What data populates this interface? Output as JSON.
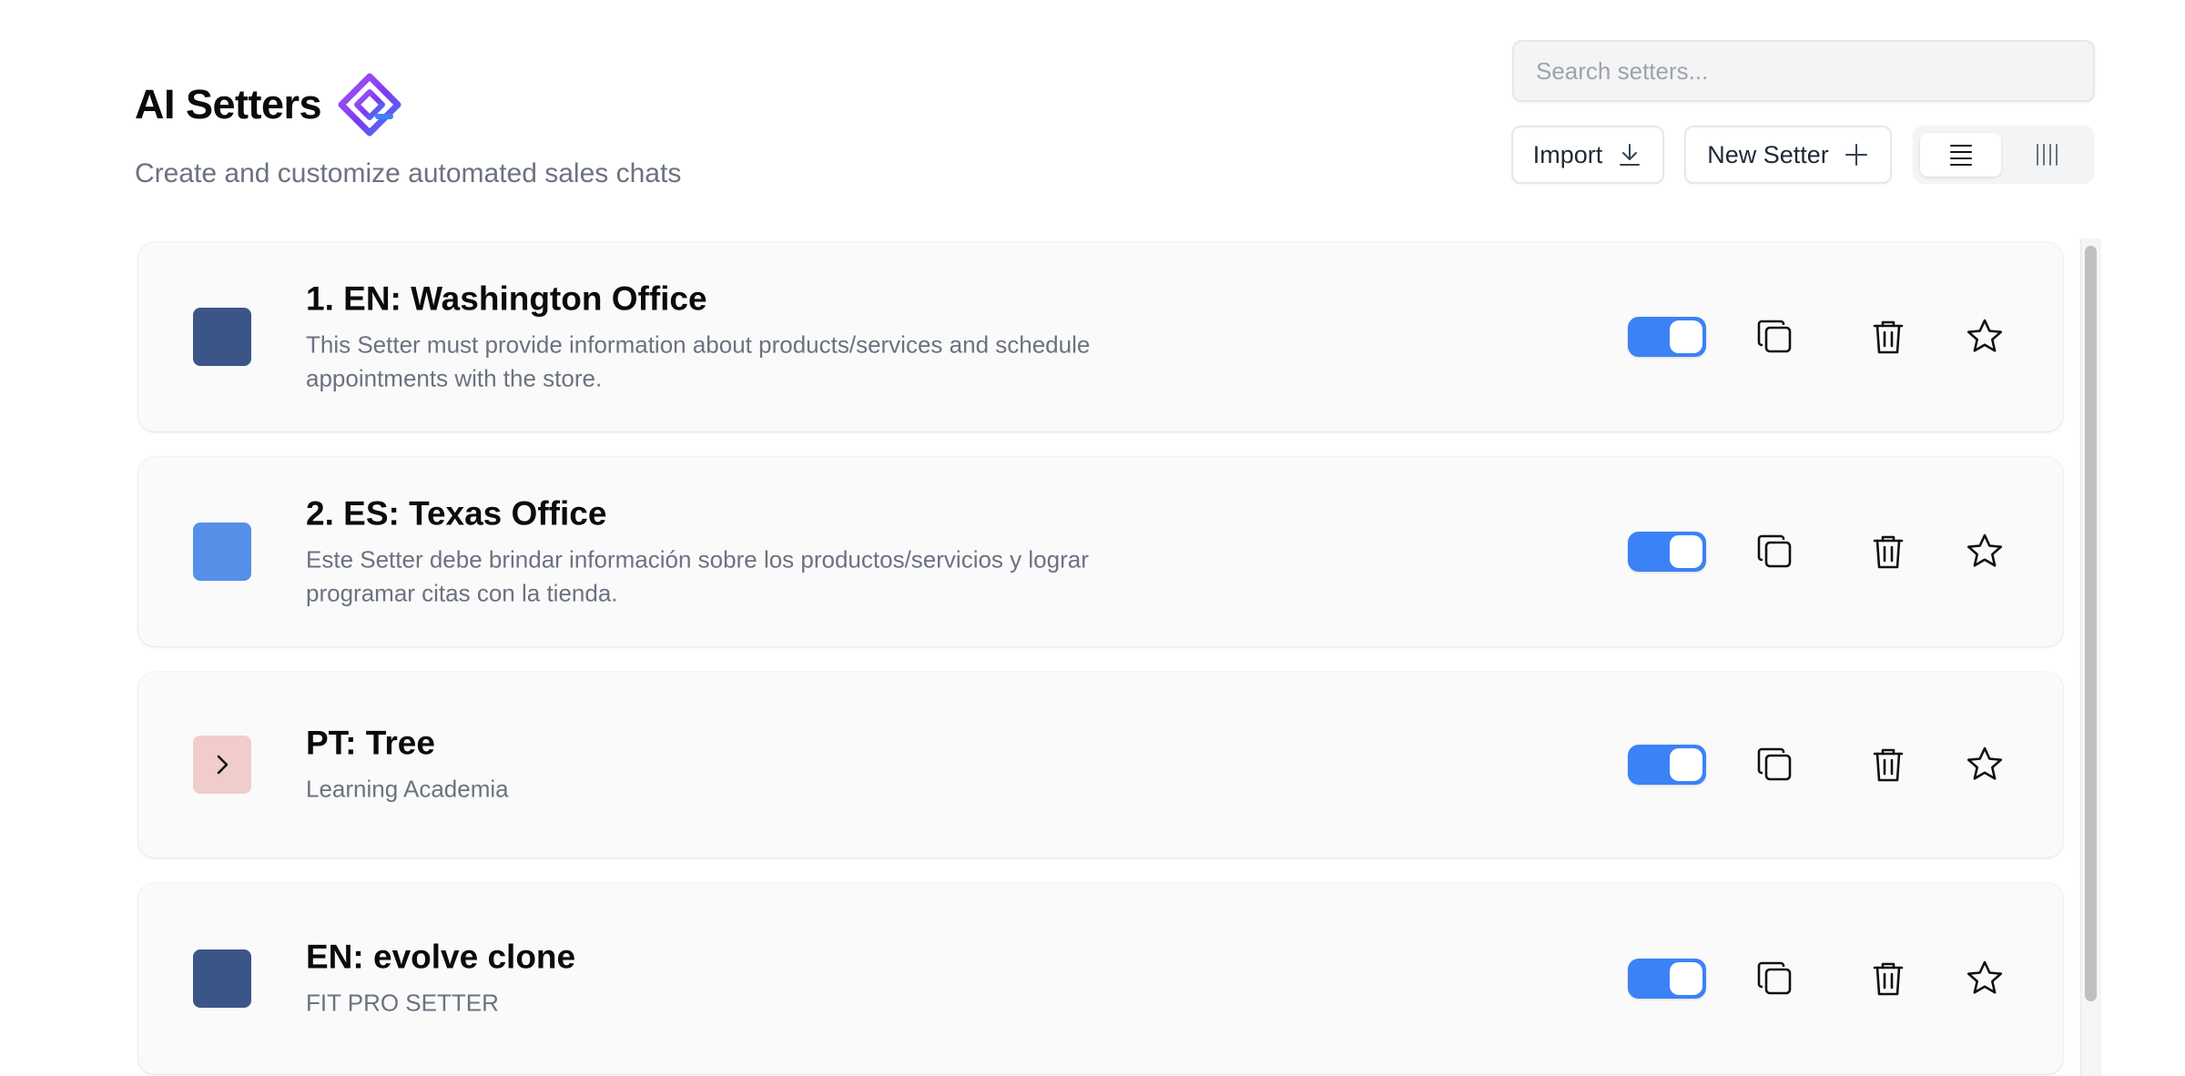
{
  "header": {
    "title": "AI Setters",
    "subtitle": "Create and customize automated sales chats"
  },
  "search": {
    "placeholder": "Search setters..."
  },
  "toolbar": {
    "import_label": "Import",
    "new_label": "New Setter",
    "view_modes": [
      "list",
      "columns"
    ],
    "active_view": "list"
  },
  "setters": [
    {
      "title": "1. EN: Washington Office",
      "description": "This Setter must provide information about products/services and schedule appointments with the store.",
      "color": "#3b5587",
      "icon": null,
      "enabled": true
    },
    {
      "title": "2. ES: Texas Office",
      "description": "Este Setter debe brindar información sobre los productos/servicios y lograr programar citas con la tienda.",
      "color": "#5590e8",
      "icon": null,
      "enabled": true
    },
    {
      "title": "PT: Tree",
      "description": "Learning Academia",
      "color": "#f0cdca",
      "icon": "chevron-right-icon",
      "enabled": true
    },
    {
      "title": "EN: evolve clone",
      "description": "FIT PRO SETTER",
      "color": "#3b5587",
      "icon": null,
      "enabled": true
    }
  ],
  "colors": {
    "accent": "#3b82f6",
    "card_bg": "#fafafa",
    "muted_text": "#6b7280"
  }
}
